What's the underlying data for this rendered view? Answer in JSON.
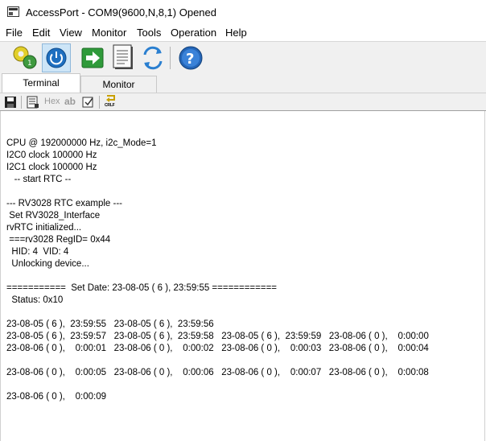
{
  "window": {
    "title": "AccessPort - COM9(9600,N,8,1) Opened"
  },
  "menu": [
    "File",
    "Edit",
    "View",
    "Monitor",
    "Tools",
    "Operation",
    "Help"
  ],
  "toolbar": {
    "buttons": [
      {
        "icon": "settings-gears-icon"
      },
      {
        "icon": "power-icon",
        "pressed": true
      },
      {
        "icon": "send-arrow-icon"
      },
      {
        "icon": "document-icon"
      },
      {
        "icon": "refresh-icon"
      },
      {
        "icon": "help-icon"
      }
    ]
  },
  "tabs": {
    "terminal": "Terminal",
    "monitor": "Monitor",
    "active": "Terminal"
  },
  "subtoolbar": {
    "hex_label": "Hex",
    "ab_label": "ab",
    "crlf_label": "CRLF"
  },
  "terminal": {
    "lines": [
      "CPU @ 192000000 Hz, i2c_Mode=1",
      "I2C0 clock 100000 Hz",
      "I2C1 clock 100000 Hz",
      "   -- start RTC --",
      "",
      "--- RV3028 RTC example ---",
      " Set RV3028_Interface",
      "rvRTC initialized...",
      " ===rv3028 RegID= 0x44",
      "  HID: 4  VID: 4",
      "  Unlocking device...",
      "",
      "===========  Set Date: 23-08-05 ( 6 ), 23:59:55 ============",
      "  Status: 0x10",
      "",
      "23-08-05 ( 6 ),  23:59:55   23-08-05 ( 6 ),  23:59:56",
      "23-08-05 ( 6 ),  23:59:57   23-08-05 ( 6 ),  23:59:58   23-08-05 ( 6 ),  23:59:59   23-08-06 ( 0 ),    0:00:00",
      "23-08-06 ( 0 ),    0:00:01   23-08-06 ( 0 ),    0:00:02   23-08-06 ( 0 ),    0:00:03   23-08-06 ( 0 ),    0:00:04",
      "",
      "23-08-06 ( 0 ),    0:00:05   23-08-06 ( 0 ),    0:00:06   23-08-06 ( 0 ),    0:00:07   23-08-06 ( 0 ),    0:00:08",
      "",
      "23-08-06 ( 0 ),    0:00:09"
    ]
  }
}
